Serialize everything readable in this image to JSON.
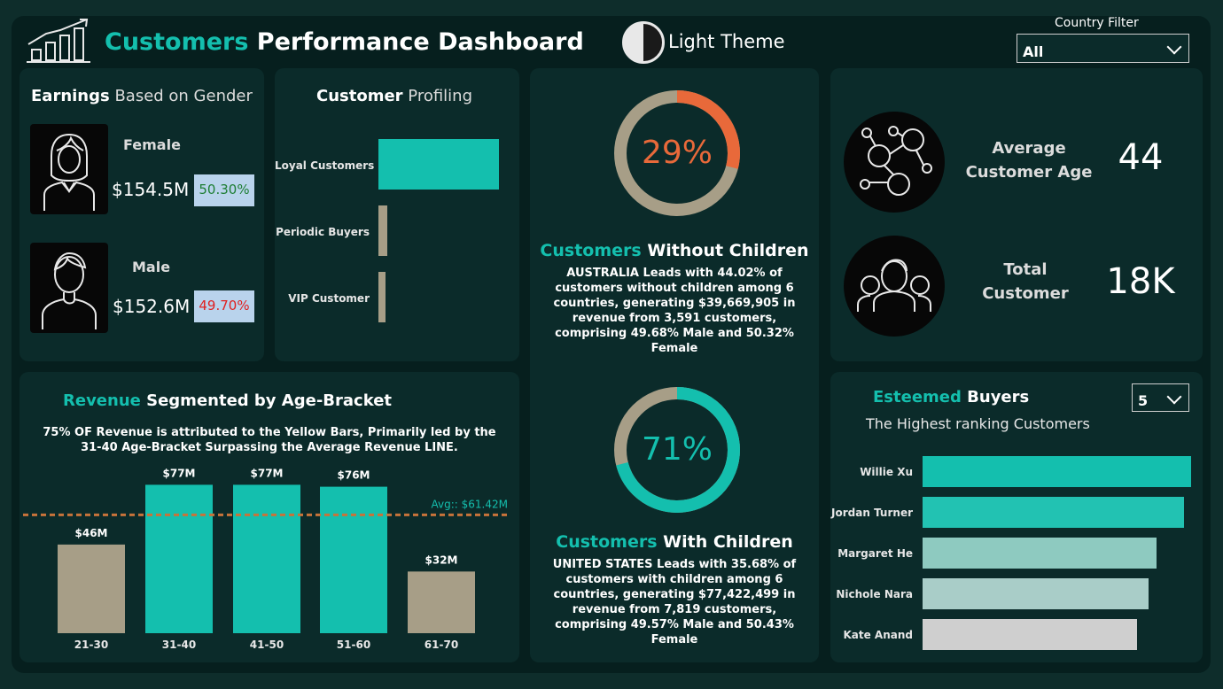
{
  "header": {
    "title_accent": "Customers",
    "title_rest": " Performance Dashboard",
    "theme_label": "Light Theme",
    "country_filter_label": "Country Filter",
    "country_filter_value": "All"
  },
  "gender": {
    "title_a": "Earnings",
    "title_b": " Based on Gender",
    "female_label": "Female",
    "female_value": "$154.5M",
    "female_pct": "50.30%",
    "male_label": "Male",
    "male_value": "$152.6M",
    "male_pct": "49.70%"
  },
  "profiling": {
    "title_a": "Customer",
    "title_b": " Profiling",
    "rows": [
      {
        "label": "Loyal Customers",
        "value": 1.0,
        "color": "#14bfae"
      },
      {
        "label": "Periodic Buyers",
        "value": 0.07,
        "color": "#a79e87"
      },
      {
        "label": "VIP Customer",
        "value": 0.05,
        "color": "#a79e87"
      }
    ]
  },
  "without_children": {
    "pct": "29%",
    "fraction": 0.29,
    "title_a": "Customers",
    "title_b": " Without Children",
    "lines": [
      "AUSTRALIA Leads with 44.02% of",
      "customers without children among 6",
      "countries, generating $39,669,905 in",
      "revenue from 3,591 customers,",
      "comprising 49.68% Male and 50.32%",
      "Female"
    ]
  },
  "with_children": {
    "pct": "71%",
    "fraction": 0.71,
    "title_a": "Customers",
    "title_b": " With Children",
    "lines": [
      "UNITED STATES Leads with 35.68% of",
      "customers with children among 6",
      "countries, generating $77,422,499 in",
      "revenue from 7,819 customers,",
      "comprising 49.57% Male and 50.43%",
      "Female"
    ]
  },
  "kpis": {
    "age_label_a": "Average",
    "age_label_b": "Customer Age",
    "age_value": "44",
    "total_label_a": "Total",
    "total_label_b": "Customer",
    "total_value": "18K"
  },
  "revenue": {
    "title_a": "Revenue",
    "title_b": " Segmented by Age-Bracket",
    "note_1": "75% OF Revenue is attributed to the Yellow Bars, Primarily led by the",
    "note_2": "31-40 Age-Bracket Surpassing the Average Revenue LINE.",
    "avg_label": "Avg:: $61.42M"
  },
  "chart_data": {
    "type": "bar",
    "categories": [
      "21-30",
      "31-40",
      "41-50",
      "51-60",
      "61-70"
    ],
    "values": [
      46,
      77,
      77,
      76,
      32
    ],
    "labels": [
      "$46M",
      "$77M",
      "$77M",
      "$76M",
      "$32M"
    ],
    "highlight": [
      false,
      true,
      true,
      true,
      false
    ],
    "average": 61.42,
    "ylim": [
      0,
      85
    ],
    "colors": {
      "highlight": "#14bfae",
      "normal": "#a79e87",
      "avg_line": "#c8733a"
    }
  },
  "buyers": {
    "title_a": "Esteemed",
    "title_b": " Buyers",
    "subtitle": "The Highest ranking Customers",
    "top_n": "5",
    "rows": [
      {
        "name": "Willie Xu",
        "value": 1.0,
        "color": "#14bfae"
      },
      {
        "name": "Jordan Turner",
        "value": 0.975,
        "color": "#22c2b2"
      },
      {
        "name": "Margaret He",
        "value": 0.87,
        "color": "#8ecac0"
      },
      {
        "name": "Nichole Nara",
        "value": 0.84,
        "color": "#a9cdc8"
      },
      {
        "name": "Kate Anand",
        "value": 0.8,
        "color": "#cfcfcf"
      }
    ]
  }
}
